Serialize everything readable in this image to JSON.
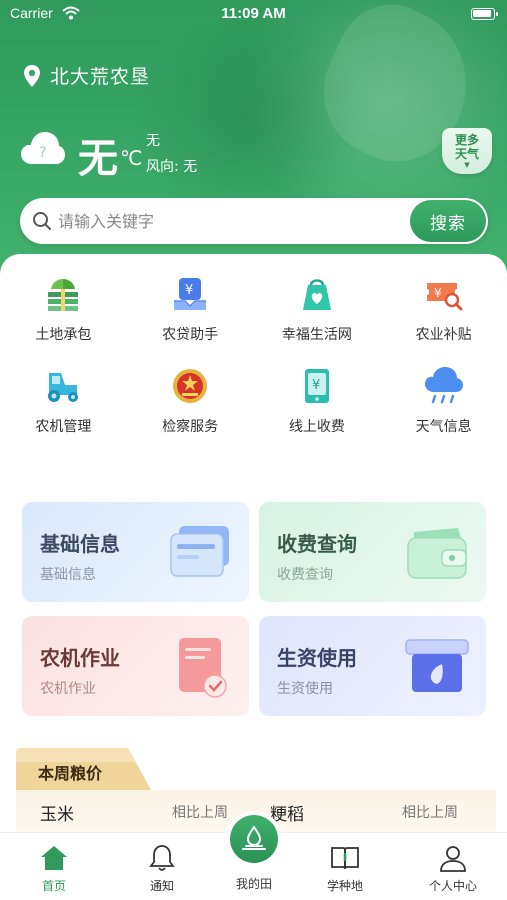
{
  "status_bar": {
    "carrier": "Carrier",
    "time": "11:09 AM"
  },
  "location": {
    "name": "北大荒农垦"
  },
  "weather": {
    "temp_value": "无",
    "temp_unit": "℃",
    "description": "无",
    "wind": "风向: 无",
    "more_label_line1": "更多",
    "more_label_line2": "天气"
  },
  "search": {
    "placeholder": "请输入关键字",
    "button_label": "搜索"
  },
  "services": [
    {
      "label": "土地承包",
      "icon": "land-contract-icon"
    },
    {
      "label": "农贷助手",
      "icon": "farm-loan-icon"
    },
    {
      "label": "幸福生活网",
      "icon": "happy-life-icon"
    },
    {
      "label": "农业补贴",
      "icon": "agri-subsidy-icon"
    },
    {
      "label": "农机管理",
      "icon": "farm-machinery-icon"
    },
    {
      "label": "检察服务",
      "icon": "procuratorate-emblem-icon"
    },
    {
      "label": "线上收费",
      "icon": "online-payment-icon"
    },
    {
      "label": "天气信息",
      "icon": "weather-rain-icon"
    }
  ],
  "cards": [
    {
      "title": "基础信息",
      "subtitle": "基础信息",
      "icon": "id-card-icon"
    },
    {
      "title": "收费查询",
      "subtitle": "收费查询",
      "icon": "wallet-icon"
    },
    {
      "title": "农机作业",
      "subtitle": "农机作业",
      "icon": "document-check-icon"
    },
    {
      "title": "生资使用",
      "subtitle": "生资使用",
      "icon": "seed-box-icon"
    }
  ],
  "grain": {
    "title": "本周粮价",
    "items": [
      {
        "name": "玉米",
        "compare": "相比上周"
      },
      {
        "name": "粳稻",
        "compare": "相比上周"
      }
    ]
  },
  "tabbar": {
    "home": "首页",
    "notice": "通知",
    "my_field": "我的田",
    "learn": "学种地",
    "profile": "个人中心"
  },
  "colors": {
    "brand_green": "#2f9a5c",
    "accent_green": "#3fb06b"
  }
}
